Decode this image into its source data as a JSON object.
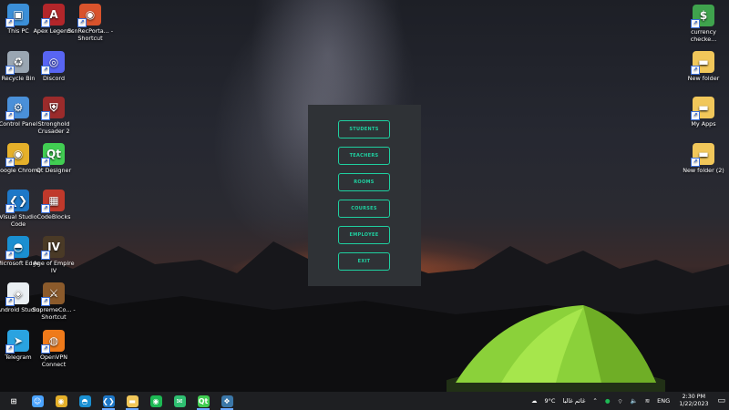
{
  "desktop_icons_left": [
    [
      {
        "label": "This PC",
        "icon": "pc-icon",
        "color": "#3b8fd8"
      },
      {
        "label": "Apex Legends",
        "icon": "apex-icon",
        "color": "#b3262a"
      },
      {
        "label": "ScnRecPorta... - Shortcut",
        "icon": "screenrec-icon",
        "color": "#d9532c"
      }
    ],
    [
      {
        "label": "Recycle Bin",
        "icon": "recycle-bin-icon",
        "color": "#9aa6b2"
      },
      {
        "label": "Discord",
        "icon": "discord-icon",
        "color": "#5865f2"
      }
    ],
    [
      {
        "label": "Control Panel",
        "icon": "control-panel-icon",
        "color": "#4a90d9"
      },
      {
        "label": "Stronghold Crusader 2",
        "icon": "stronghold-icon",
        "color": "#9b2b2b"
      }
    ],
    [
      {
        "label": "Google Chrome",
        "icon": "chrome-icon",
        "color": "#e5b02a"
      },
      {
        "label": "Qt Designer",
        "icon": "qt-icon",
        "color": "#41cd52"
      }
    ],
    [
      {
        "label": "Visual Studio Code",
        "icon": "vscode-icon",
        "color": "#1e78c8"
      },
      {
        "label": "CodeBlocks",
        "icon": "codeblocks-icon",
        "color": "#c0392b"
      }
    ],
    [
      {
        "label": "Microsoft Edge",
        "icon": "edge-icon",
        "color": "#1a8fd1"
      },
      {
        "label": "Age of Empire IV",
        "icon": "aoe-icon",
        "color": "#4a3a26"
      }
    ],
    [
      {
        "label": "Android Studio",
        "icon": "android-studio-icon",
        "color": "#e9eef2"
      },
      {
        "label": "SupremeCo... - Shortcut",
        "icon": "supreme-icon",
        "color": "#8b5a2b"
      }
    ],
    [
      {
        "label": "Telegram",
        "icon": "telegram-icon",
        "color": "#2aa3e0"
      },
      {
        "label": "OpenVPN Connect",
        "icon": "openvpn-icon",
        "color": "#ef7a1a"
      }
    ]
  ],
  "desktop_icons_right": [
    {
      "label": "currency checke...",
      "icon": "currency-checker-icon",
      "color": "#3fa34d"
    },
    {
      "label": "New folder",
      "icon": "folder-icon",
      "color": "#f1c75a"
    },
    {
      "label": "My Apps",
      "icon": "folder-icon",
      "color": "#f1c75a"
    },
    {
      "label": "New folder (2)",
      "icon": "folder-icon",
      "color": "#f1c75a"
    }
  ],
  "menu": {
    "buttons": [
      "STUDENTS",
      "TEACHERS",
      "ROOMS",
      "COURSES",
      "EMPLOYEE",
      "EXIT"
    ],
    "accent": "#1fd0a0"
  },
  "taskbar": {
    "items": [
      {
        "icon": "windows-start-icon",
        "color": "#ffffff",
        "active": false
      },
      {
        "icon": "person-icon",
        "color": "#4aa3ff",
        "active": false
      },
      {
        "icon": "chrome-icon",
        "color": "#e5b02a",
        "active": false
      },
      {
        "icon": "edge-icon",
        "color": "#1a8fd1",
        "active": false
      },
      {
        "icon": "vscode-icon",
        "color": "#1e78c8",
        "active": true
      },
      {
        "icon": "file-explorer-icon",
        "color": "#f1c75a",
        "active": true
      },
      {
        "icon": "spotify-icon",
        "color": "#1db954",
        "active": false
      },
      {
        "icon": "chat-icon",
        "color": "#2fbf71",
        "active": false
      },
      {
        "icon": "qt-icon",
        "color": "#41cd52",
        "active": true
      },
      {
        "icon": "python-icon",
        "color": "#3b77a8",
        "active": true
      }
    ],
    "weather": "9°C",
    "weather_text": "غائم غالبا",
    "language": "ENG",
    "time": "2:30 PM",
    "date": "1/22/2023"
  }
}
